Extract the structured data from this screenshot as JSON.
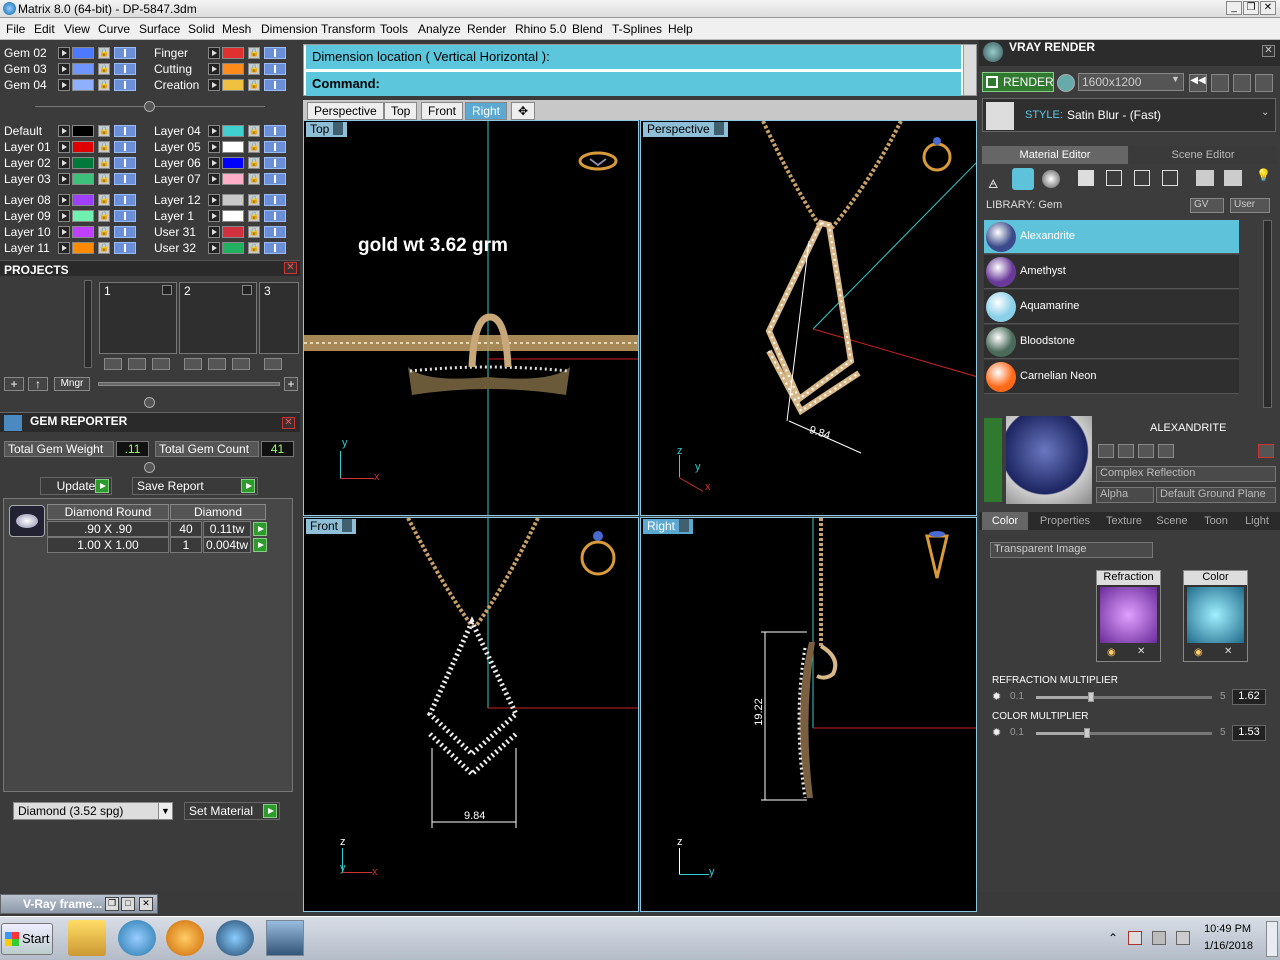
{
  "window": {
    "title": "Matrix 8.0 (64-bit) - DP-5847.3dm",
    "controls": [
      "_",
      "❐",
      "✕"
    ]
  },
  "menu": [
    "File",
    "Edit",
    "View",
    "Curve",
    "Surface",
    "Solid",
    "Mesh",
    "Dimension",
    "Transform",
    "Tools",
    "Analyze",
    "Render",
    "Rhino 5.0",
    "Blend",
    "T-Splines",
    "Help"
  ],
  "gem_layers": [
    {
      "name": "Gem 02",
      "color": "#4d79ff"
    },
    {
      "name": "Gem 03",
      "color": "#6f95ff"
    },
    {
      "name": "Gem 04",
      "color": "#8fb0ff"
    }
  ],
  "gem_layers_right": [
    {
      "name": "Finger",
      "color": "#e03030"
    },
    {
      "name": "Cutting",
      "color": "#ff8c1a"
    },
    {
      "name": "Creation",
      "color": "#f0c040"
    }
  ],
  "layers_col1": [
    {
      "name": "Default",
      "color": "#000000"
    },
    {
      "name": "Layer 01",
      "color": "#e00000"
    },
    {
      "name": "Layer 02",
      "color": "#007a3a"
    },
    {
      "name": "Layer 03",
      "color": "#3cc07a"
    },
    {
      "name": "Layer 08",
      "color": "#a040ff"
    },
    {
      "name": "Layer 09",
      "color": "#70f0b0"
    },
    {
      "name": "Layer 10",
      "color": "#c040ff"
    },
    {
      "name": "Layer 11",
      "color": "#ff8c00"
    }
  ],
  "layers_col2": [
    {
      "name": "Layer 04",
      "color": "#40d0d0"
    },
    {
      "name": "Layer 05",
      "color": "#ffffff"
    },
    {
      "name": "Layer 06",
      "color": "#0000ff"
    },
    {
      "name": "Layer 07",
      "color": "#ffb0c8"
    },
    {
      "name": "Layer 12",
      "color": "#c8c8c8"
    },
    {
      "name": "Layer 1",
      "color": "#ffffff"
    },
    {
      "name": "User 31",
      "color": "#d03040"
    },
    {
      "name": "User 32",
      "color": "#20b060"
    }
  ],
  "projects": {
    "title": "PROJECTS",
    "slots": [
      "1",
      "2",
      "3"
    ],
    "mngr_label": "Mngr"
  },
  "gem_reporter": {
    "title": "GEM REPORTER",
    "total_weight_label": "Total Gem Weight",
    "total_weight": ".11",
    "total_count_label": "Total Gem Count",
    "total_count": "41",
    "update_label": "Update",
    "save_report_label": "Save Report",
    "table_headers": [
      "Diamond Round",
      "Diamond"
    ],
    "rows": [
      {
        "size": ".90 X .90",
        "count": "40",
        "weight": "0.11tw"
      },
      {
        "size": "1.00 X 1.00",
        "count": "1",
        "weight": "0.004tw"
      }
    ],
    "material_select": "Diamond    (3.52 spg)",
    "set_material_label": "Set Material"
  },
  "vray_frame": {
    "title": "V-Ray frame..."
  },
  "command": {
    "prompt1": "Dimension location ( Vertical  Horizontal ):",
    "prompt2": "Command:"
  },
  "view_tabs": [
    "Perspective",
    "Top",
    "Front",
    "Right"
  ],
  "viewports": {
    "top": {
      "label": "Top",
      "annotation": "gold wt 3.62 grm"
    },
    "perspective": {
      "label": "Perspective",
      "dimension": "9.84"
    },
    "front": {
      "label": "Front",
      "dimension": "9.84"
    },
    "right": {
      "label": "Right",
      "dimension": "19.22"
    }
  },
  "axes": {
    "x": "x",
    "y": "y",
    "z": "z"
  },
  "vray": {
    "title": "VRAY RENDER",
    "render_label": "RENDER",
    "resolution": "1600x1200",
    "style_label": "STYLE:",
    "style_value": "Satin Blur - (Fast)",
    "tabs": [
      "Material Editor",
      "Scene Editor"
    ],
    "library_label": "LIBRARY: Gem",
    "lib_buttons": [
      "GV",
      "User"
    ],
    "materials": [
      {
        "name": "Alexandrite",
        "color": "#3a4a8a"
      },
      {
        "name": "Amethyst",
        "color": "#6a3a9a"
      },
      {
        "name": "Aquamarine",
        "color": "#8ad0e8"
      },
      {
        "name": "Bloodstone",
        "color": "#4a6a5a"
      },
      {
        "name": "Carnelian Neon",
        "color": "#ff6a1a"
      }
    ],
    "selected_name": "ALEXANDRITE",
    "reflection_mode": "Complex Reflection",
    "alpha_label": "Alpha",
    "ground_plane": "Default Ground Plane",
    "prop_tabs": [
      "Color",
      "Properties",
      "Texture",
      "Scene",
      "Toon",
      "Light"
    ],
    "transparent_image": "Transparent Image",
    "refraction_label": "Refraction",
    "color_label": "Color",
    "refraction_multiplier_label": "REFRACTION MULTIPLIER",
    "refraction_min": "0.1",
    "refraction_max": "5",
    "refraction_value": "1.62",
    "refraction_level": 0.31,
    "color_multiplier_label": "COLOR MULTIPLIER",
    "color_min": "0.1",
    "color_max": "5",
    "color_value": "1.53",
    "color_level": 0.29
  },
  "taskbar": {
    "start_label": "Start",
    "time": "10:49 PM",
    "date": "1/16/2018"
  }
}
